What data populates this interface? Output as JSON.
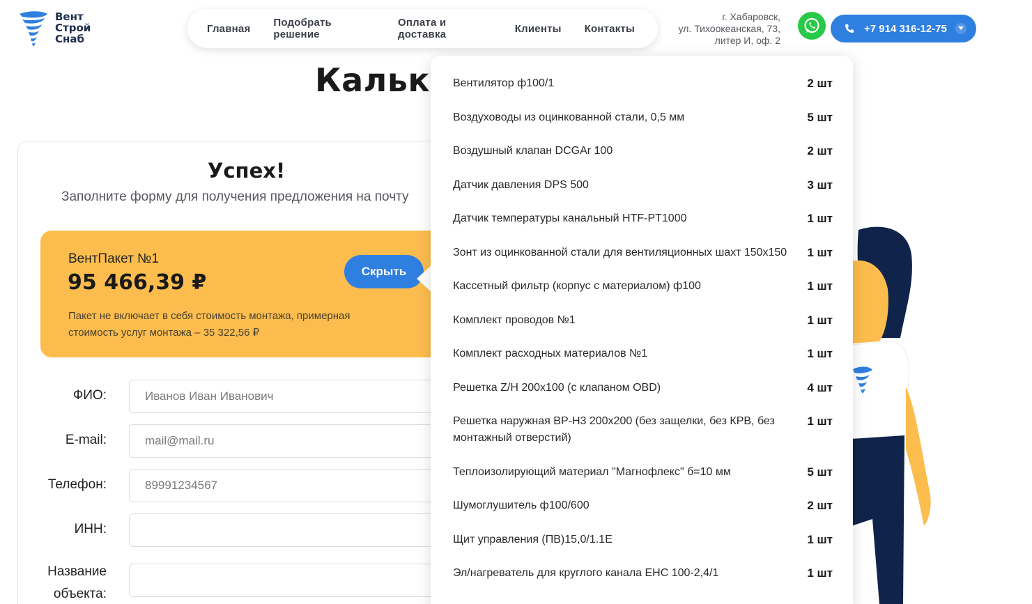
{
  "logo": {
    "line1": "Вент",
    "line2": "Строй",
    "line3": "Снаб"
  },
  "nav": [
    "Главная",
    "Подобрать решение",
    "Оплата и доставка",
    "Клиенты",
    "Контакты"
  ],
  "address": {
    "line1": "г. Хабаровск,",
    "line2": "ул. Тихоокеанская, 73,",
    "line3": "литер И, оф. 2"
  },
  "phone": "+7 914 316-12-75",
  "page_title": "Кальку",
  "success": {
    "title": "Успех!",
    "subtitle": "Заполните форму для получения предложения на почту"
  },
  "package": {
    "name": "ВентПакет №1",
    "price": "95 466,39 ₽",
    "note": "Пакет не включает в себя стоимость монтажа, примерная стоимость услуг монтажа – 35 322,56 ₽",
    "hide_label": "Скрыть"
  },
  "form": {
    "fio_label": "ФИО:",
    "fio_placeholder": "Иванов Иван Иванович",
    "email_label": "E-mail:",
    "email_placeholder": "mail@mail.ru",
    "phone_label": "Телефон:",
    "phone_placeholder": "89991234567",
    "inn_label": "ИНН:",
    "object_label_1": "Название",
    "object_label_2": "объекта:"
  },
  "items": [
    {
      "name": "Вентилятор ф100/1",
      "qty": "2 шт"
    },
    {
      "name": "Воздуховоды из оцинкованной стали, 0,5 мм",
      "qty": "5 шт"
    },
    {
      "name": "Воздушный клапан DCGAr 100",
      "qty": "2 шт"
    },
    {
      "name": "Датчик давления DPS 500",
      "qty": "3 шт"
    },
    {
      "name": "Датчик температуры канальный HTF-PT1000",
      "qty": "1 шт"
    },
    {
      "name": "Зонт из оцинкованной стали для вентиляционных шахт 150х150",
      "qty": "1 шт"
    },
    {
      "name": "Кассетный фильтр (корпус с материалом) ф100",
      "qty": "1 шт"
    },
    {
      "name": "Комплект проводов №1",
      "qty": "1 шт"
    },
    {
      "name": "Комплект расходных материалов №1",
      "qty": "1 шт"
    },
    {
      "name": "Решетка Z/H 200x100 (с клапаном OBD)",
      "qty": "4 шт"
    },
    {
      "name": "Решетка наружная ВР-Н3 200х200 (без защелки, без КРВ, без монтажный отверстий)",
      "qty": "1 шт"
    },
    {
      "name": "Теплоизолирующий материал \"Магнофлекс\" б=10 мм",
      "qty": "5 шт"
    },
    {
      "name": "Шумоглушитель ф100/600",
      "qty": "2 шт"
    },
    {
      "name": "Щит управления (ПВ)15,0/1.1Е",
      "qty": "1 шт"
    },
    {
      "name": "Эл/нагреватель для круглого канала ЕНС 100-2,4/1",
      "qty": "1 шт"
    }
  ],
  "colors": {
    "accent_blue": "#2f7fe0",
    "package_yellow": "#fcbd4e",
    "whatsapp_green": "#28c948",
    "navy": "#1e2f4d"
  },
  "icons": [
    "tornado-logo-icon",
    "whatsapp-icon",
    "phone-icon",
    "chevron-down-icon"
  ]
}
